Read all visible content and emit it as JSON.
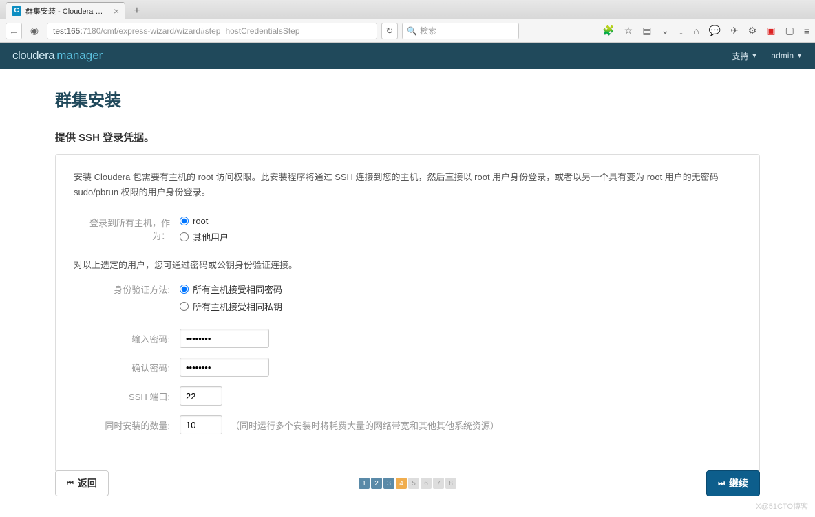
{
  "browser": {
    "tab_title": "群集安装 - Cloudera Ma...",
    "url_host": "test165:",
    "url_path": "7180/cmf/express-wizard/wizard#step=hostCredentialsStep",
    "search_placeholder": "検索"
  },
  "header": {
    "brand1": "cloudera",
    "brand2": "manager",
    "support": "支持",
    "admin": "admin"
  },
  "page": {
    "title": "群集安装",
    "subtitle": "提供 SSH 登录凭据。",
    "intro": "安装 Cloudera 包需要有主机的 root 访问权限。此安装程序将通过 SSH 连接到您的主机，然后直接以 root 用户身份登录，或者以另一个具有变为 root 用户的无密码 sudo/pbrun 权限的用户身份登录。",
    "login_as_label": "登录到所有主机，作为：",
    "login_opt_root": "root",
    "login_opt_other": "其他用户",
    "auth_note": "对以上选定的用户，您可通过密码或公钥身份验证连接。",
    "auth_method_label": "身份验证方法:",
    "auth_opt_password": "所有主机接受相同密码",
    "auth_opt_key": "所有主机接受相同私钥",
    "password_label": "输入密码:",
    "password_value": "••••••••",
    "confirm_label": "确认密码:",
    "confirm_value": "••••••••",
    "ssh_port_label": "SSH 端口:",
    "ssh_port_value": "22",
    "concurrent_label": "同时安装的数量:",
    "concurrent_value": "10",
    "concurrent_note": "（同时运行多个安装时将耗费大量的网络带宽和其他其他系统资源）"
  },
  "footer": {
    "back": "返回",
    "continue": "继续",
    "steps": [
      "1",
      "2",
      "3",
      "4",
      "5",
      "6",
      "7",
      "8"
    ],
    "current_step": 4
  },
  "watermark": "X@51CTO博客"
}
